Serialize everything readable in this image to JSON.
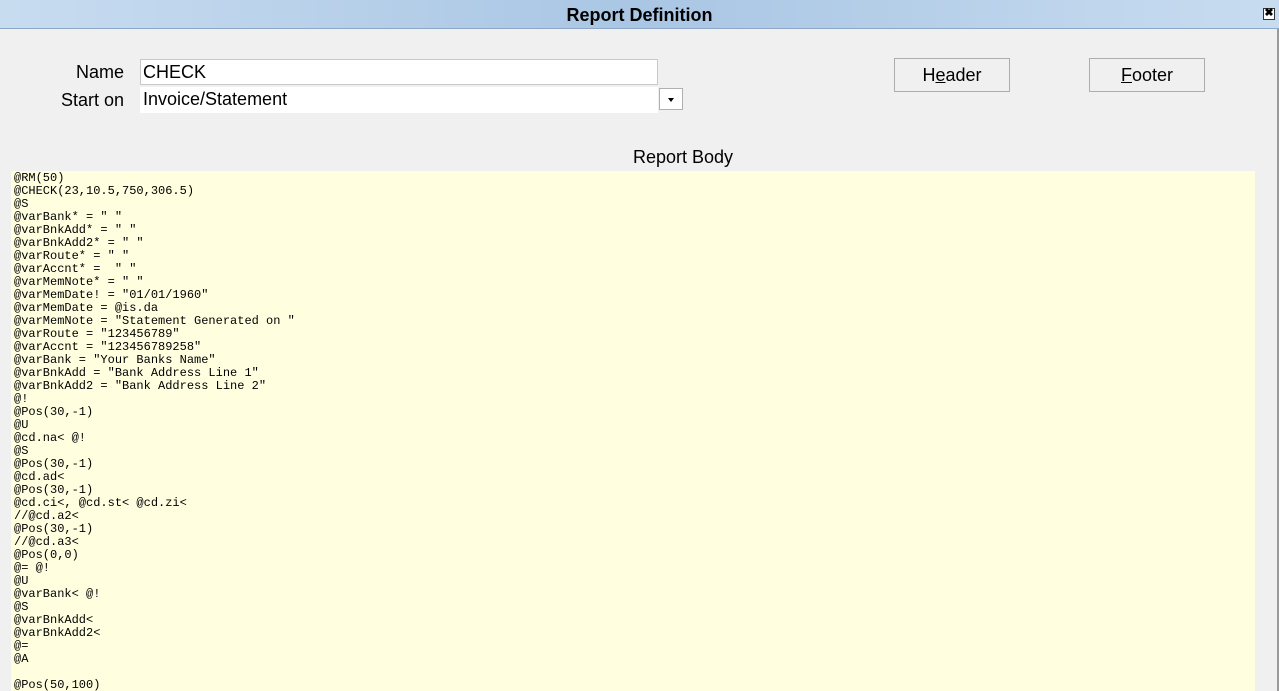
{
  "window": {
    "title": "Report Definition",
    "close_glyph": "✖"
  },
  "form": {
    "name_label": "Name",
    "name_value": "CHECK",
    "start_label": "Start on",
    "start_value": "Invoice/Statement"
  },
  "buttons": {
    "header_label": "Header",
    "footer_label": "Footer"
  },
  "report_body": {
    "title": "Report Body",
    "content": "@RM(50)\n@CHECK(23,10.5,750,306.5)\n@S\n@varBank* = \" \"\n@varBnkAdd* = \" \"\n@varBnkAdd2* = \" \"\n@varRoute* = \" \"\n@varAccnt* =  \" \"\n@varMemNote* = \" \"\n@varMemDate! = \"01/01/1960\"\n@varMemDate = @is.da\n@varMemNote = \"Statement Generated on \"\n@varRoute = \"123456789\"\n@varAccnt = \"123456789258\"\n@varBank = \"Your Banks Name\"\n@varBnkAdd = \"Bank Address Line 1\"\n@varBnkAdd2 = \"Bank Address Line 2\"\n@!\n@Pos(30,-1)\n@U\n@cd.na< @!\n@S\n@Pos(30,-1)\n@cd.ad<\n@Pos(30,-1)\n@cd.ci<, @cd.st< @cd.zi<\n//@cd.a2<\n@Pos(30,-1)\n//@cd.a3<\n@Pos(0,0)\n@= @!\n@U\n@varBank< @!\n@S\n@varBnkAdd<\n@varBnkAdd2<\n@=\n@A\n\n@Pos(50,100)"
  },
  "icons": {
    "close": "close-icon",
    "dropdown": "chevron-down-icon"
  },
  "colors": {
    "titlebar": "#a9c6e4",
    "report_body_bg": "#ffffe0",
    "window_bg": "#f0f0f0"
  }
}
